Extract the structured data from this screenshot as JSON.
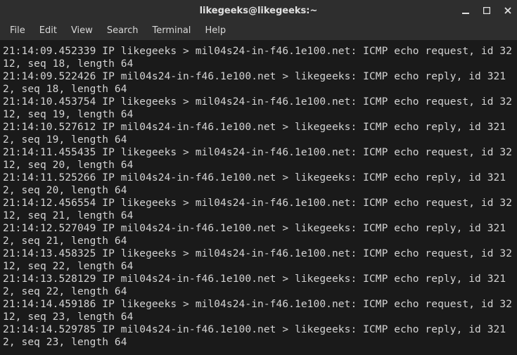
{
  "window": {
    "title": "likegeeks@likegeeks:~"
  },
  "menubar": {
    "items": [
      "File",
      "Edit",
      "View",
      "Search",
      "Terminal",
      "Help"
    ]
  },
  "terminal": {
    "lines": [
      "21:14:09.452339 IP likegeeks > mil04s24-in-f46.1e100.net: ICMP echo request, id 3212, seq 18, length 64",
      "21:14:09.522426 IP mil04s24-in-f46.1e100.net > likegeeks: ICMP echo reply, id 3212, seq 18, length 64",
      "21:14:10.453754 IP likegeeks > mil04s24-in-f46.1e100.net: ICMP echo request, id 3212, seq 19, length 64",
      "21:14:10.527612 IP mil04s24-in-f46.1e100.net > likegeeks: ICMP echo reply, id 3212, seq 19, length 64",
      "21:14:11.455435 IP likegeeks > mil04s24-in-f46.1e100.net: ICMP echo request, id 3212, seq 20, length 64",
      "21:14:11.525266 IP mil04s24-in-f46.1e100.net > likegeeks: ICMP echo reply, id 3212, seq 20, length 64",
      "21:14:12.456554 IP likegeeks > mil04s24-in-f46.1e100.net: ICMP echo request, id 3212, seq 21, length 64",
      "21:14:12.527049 IP mil04s24-in-f46.1e100.net > likegeeks: ICMP echo reply, id 3212, seq 21, length 64",
      "21:14:13.458325 IP likegeeks > mil04s24-in-f46.1e100.net: ICMP echo request, id 3212, seq 22, length 64",
      "21:14:13.528129 IP mil04s24-in-f46.1e100.net > likegeeks: ICMP echo reply, id 3212, seq 22, length 64",
      "21:14:14.459186 IP likegeeks > mil04s24-in-f46.1e100.net: ICMP echo request, id 3212, seq 23, length 64",
      "21:14:14.529785 IP mil04s24-in-f46.1e100.net > likegeeks: ICMP echo reply, id 3212, seq 23, length 64"
    ]
  }
}
